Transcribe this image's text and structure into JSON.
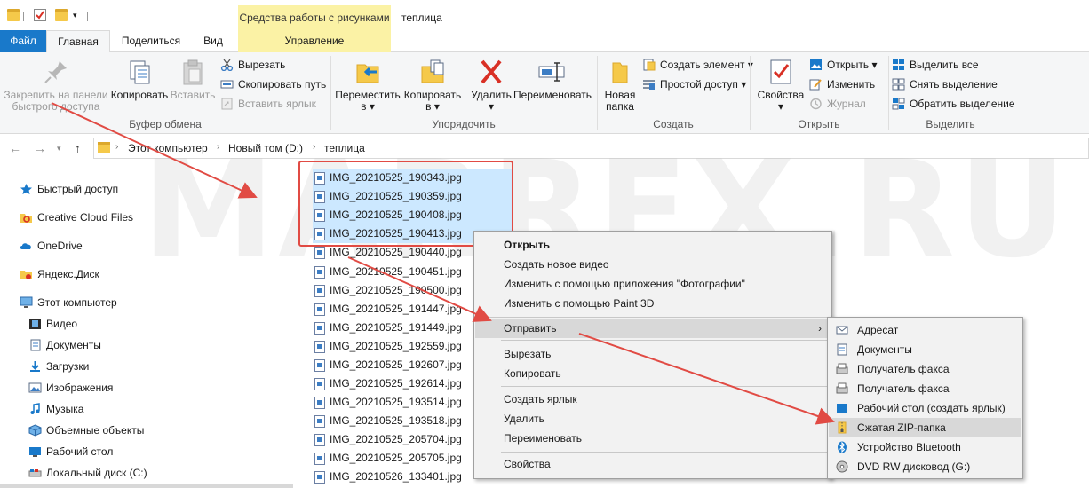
{
  "window": {
    "title": "теплица",
    "context_tab_header": "Средства работы с рисунками"
  },
  "tabs": {
    "file": "Файл",
    "home": "Главная",
    "share": "Поделиться",
    "view": "Вид",
    "manage": "Управление"
  },
  "ribbon": {
    "clipboard": {
      "pin_line1": "Закрепить на панели",
      "pin_line2": "быстрого доступа",
      "copy": "Копировать",
      "paste": "Вставить",
      "cut": "Вырезать",
      "copy_path": "Скопировать путь",
      "paste_shortcut": "Вставить ярлык",
      "label": "Буфер обмена"
    },
    "organize": {
      "move_line1": "Переместить",
      "move_line2": "в",
      "copy_line1": "Копировать",
      "copy_line2": "в",
      "delete": "Удалить",
      "rename": "Переименовать",
      "label": "Упорядочить"
    },
    "create": {
      "new_folder_line1": "Новая",
      "new_folder_line2": "папка",
      "new_item": "Создать элемент",
      "easy_access": "Простой доступ",
      "label": "Создать"
    },
    "open": {
      "properties": "Свойства",
      "open": "Открыть",
      "edit": "Изменить",
      "history": "Журнал",
      "label": "Открыть"
    },
    "select": {
      "select_all": "Выделить все",
      "select_none": "Снять выделение",
      "invert": "Обратить выделение",
      "label": "Выделить"
    }
  },
  "address": {
    "crumbs": [
      "Этот компьютер",
      "Новый том (D:)",
      "теплица"
    ]
  },
  "nav": {
    "items": [
      {
        "label": "Быстрый доступ",
        "icon": "star-icon"
      },
      {
        "label": "Creative Cloud Files",
        "icon": "creative-cloud-icon"
      },
      {
        "label": "OneDrive",
        "icon": "cloud-icon"
      },
      {
        "label": "Яндекс.Диск",
        "icon": "yandex-disk-icon"
      },
      {
        "label": "Этот компьютер",
        "icon": "computer-icon"
      },
      {
        "label": "Видео",
        "icon": "video-icon"
      },
      {
        "label": "Документы",
        "icon": "documents-icon"
      },
      {
        "label": "Загрузки",
        "icon": "downloads-icon"
      },
      {
        "label": "Изображения",
        "icon": "pictures-icon"
      },
      {
        "label": "Музыка",
        "icon": "music-icon"
      },
      {
        "label": "Объемные объекты",
        "icon": "3d-objects-icon"
      },
      {
        "label": "Рабочий стол",
        "icon": "desktop-icon"
      },
      {
        "label": "Локальный диск (C:)",
        "icon": "drive-icon"
      }
    ]
  },
  "files": [
    {
      "name": "IMG_20210525_190343.jpg",
      "selected": true
    },
    {
      "name": "IMG_20210525_190359.jpg",
      "selected": true
    },
    {
      "name": "IMG_20210525_190408.jpg",
      "selected": true
    },
    {
      "name": "IMG_20210525_190413.jpg",
      "selected": true
    },
    {
      "name": "IMG_20210525_190440.jpg",
      "selected": false
    },
    {
      "name": "IMG_20210525_190451.jpg",
      "selected": false
    },
    {
      "name": "IMG_20210525_190500.jpg",
      "selected": false
    },
    {
      "name": "IMG_20210525_191447.jpg",
      "selected": false
    },
    {
      "name": "IMG_20210525_191449.jpg",
      "selected": false
    },
    {
      "name": "IMG_20210525_192559.jpg",
      "selected": false
    },
    {
      "name": "IMG_20210525_192607.jpg",
      "selected": false
    },
    {
      "name": "IMG_20210525_192614.jpg",
      "selected": false
    },
    {
      "name": "IMG_20210525_193514.jpg",
      "selected": false
    },
    {
      "name": "IMG_20210525_193518.jpg",
      "selected": false
    },
    {
      "name": "IMG_20210525_205704.jpg",
      "selected": false
    },
    {
      "name": "IMG_20210525_205705.jpg",
      "selected": false
    },
    {
      "name": "IMG_20210526_133401.jpg",
      "selected": false
    }
  ],
  "context_menu": {
    "open": "Открыть",
    "new_video": "Создать новое видео",
    "edit_photos": "Изменить с помощью приложения \"Фотографии\"",
    "edit_paint3d": "Изменить с помощью Paint 3D",
    "send_to": "Отправить",
    "cut": "Вырезать",
    "copy": "Копировать",
    "create_shortcut": "Создать ярлык",
    "delete": "Удалить",
    "rename": "Переименовать",
    "properties": "Свойства"
  },
  "send_to_menu": {
    "items": [
      {
        "label": "Адресат",
        "icon": "mail-recipient-icon"
      },
      {
        "label": "Документы",
        "icon": "documents-icon"
      },
      {
        "label": "Получатель факса",
        "icon": "fax-icon"
      },
      {
        "label": "Получатель факса",
        "icon": "fax-icon"
      },
      {
        "label": "Рабочий стол (создать ярлык)",
        "icon": "desktop-icon"
      },
      {
        "label": "Сжатая ZIP-папка",
        "icon": "zip-folder-icon"
      },
      {
        "label": "Устройство Bluetooth",
        "icon": "bluetooth-icon"
      },
      {
        "label": "DVD RW дисковод (G:)",
        "icon": "dvd-drive-icon"
      }
    ],
    "highlighted_index": 5
  },
  "watermark": "MARREX.RU",
  "colors": {
    "accent": "#1979ca",
    "selection": "#cce8ff",
    "annotation": "#e14b44",
    "context_tab": "#fbf2a5"
  }
}
